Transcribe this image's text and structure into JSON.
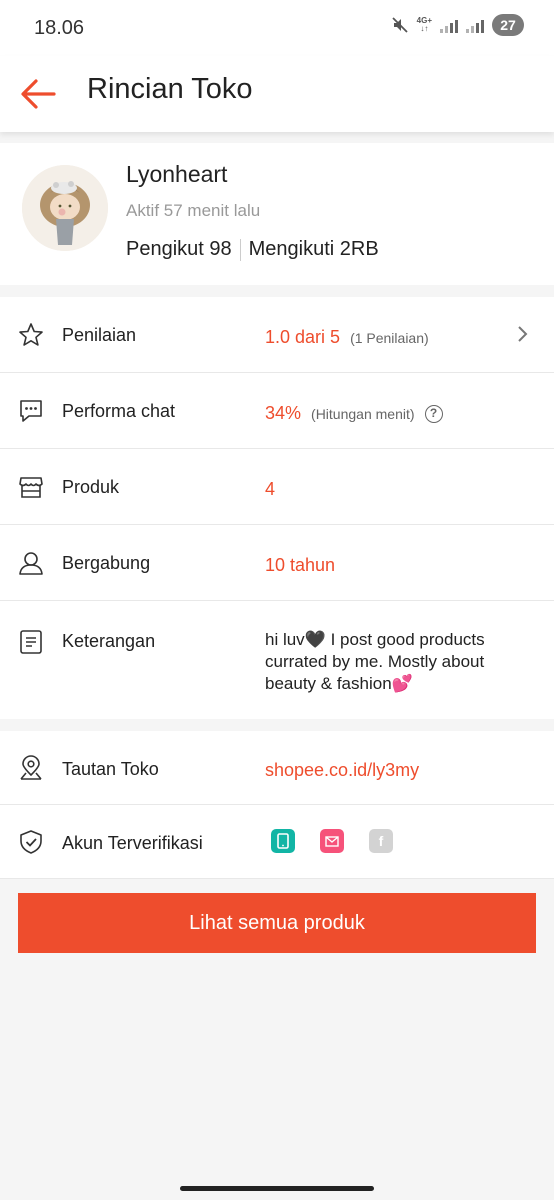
{
  "status_bar": {
    "time": "18.06",
    "network": "4G+",
    "battery": "27"
  },
  "header": {
    "title": "Rincian Toko"
  },
  "profile": {
    "name": "Lyonheart",
    "active": "Aktif 57 menit lalu",
    "followers": "Pengikut 98",
    "following": "Mengikuti 2RB"
  },
  "rows": {
    "rating": {
      "label": "Penilaian",
      "value": "1.0 dari 5",
      "sub": "(1 Penilaian)"
    },
    "chat": {
      "label": "Performa chat",
      "value": "34%",
      "sub": "(Hitungan menit)",
      "help": "?"
    },
    "products": {
      "label": "Produk",
      "value": "4"
    },
    "joined": {
      "label": "Bergabung",
      "value": "10 tahun"
    },
    "description": {
      "label": "Keterangan",
      "value": "hi luv🖤 I post good products currated by me. Mostly about beauty & fashion💕"
    },
    "link": {
      "label": "Tautan Toko",
      "value": "shopee.co.id/ly3my"
    },
    "verified": {
      "label": "Akun Terverifikasi",
      "facebook_letter": "f"
    }
  },
  "cta": {
    "label": "Lihat semua produk"
  },
  "colors": {
    "accent": "#ee4d2d",
    "phone_badge": "#12b5a5",
    "email_badge": "#f6527a",
    "facebook_badge": "#d3d3d3"
  },
  "icons": [
    "back-arrow-icon",
    "mute-icon",
    "signal-icon",
    "battery-icon",
    "star-icon",
    "chat-icon",
    "store-icon",
    "person-icon",
    "document-icon",
    "location-pin-icon",
    "shield-check-icon",
    "phone-badge-icon",
    "email-badge-icon",
    "facebook-badge-icon",
    "chevron-right-icon",
    "question-icon"
  ]
}
